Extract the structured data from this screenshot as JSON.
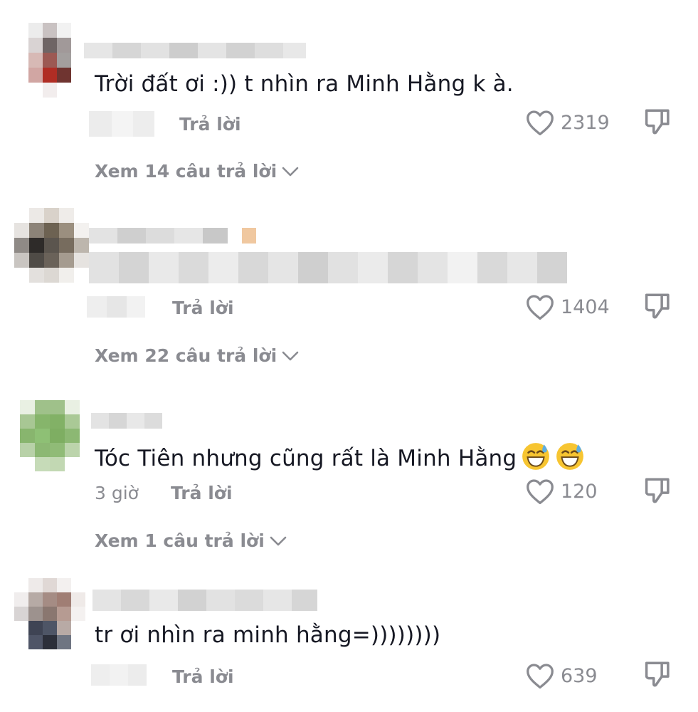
{
  "comments": [
    {
      "text": "Trời đất ơi :)) t nhìn ra Minh Hằng k à.",
      "time": "",
      "reply_label": "Trả lời",
      "likes": "2319",
      "view_replies": "Xem 14 câu trả lời"
    },
    {
      "text": "",
      "time": "",
      "reply_label": "Trả lời",
      "likes": "1404",
      "view_replies": "Xem 22 câu trả lời"
    },
    {
      "text": "Tóc Tiên nhưng cũng rất là Minh Hằng",
      "emoji": "sweat-smile-emoji",
      "time": "3 giờ",
      "reply_label": "Trả lời",
      "likes": "120",
      "view_replies": "Xem 1 câu trả lời"
    },
    {
      "text": "tr ơi nhìn ra minh hằng=))))))))",
      "time": "",
      "reply_label": "Trả lời",
      "likes": "639"
    }
  ],
  "icons": {
    "like": "heart-outline-icon",
    "dislike": "thumbs-down-icon",
    "expand": "chevron-down-icon"
  },
  "colors": {
    "text": "#161823",
    "secondary": "#8a8b91",
    "background": "#ffffff"
  }
}
